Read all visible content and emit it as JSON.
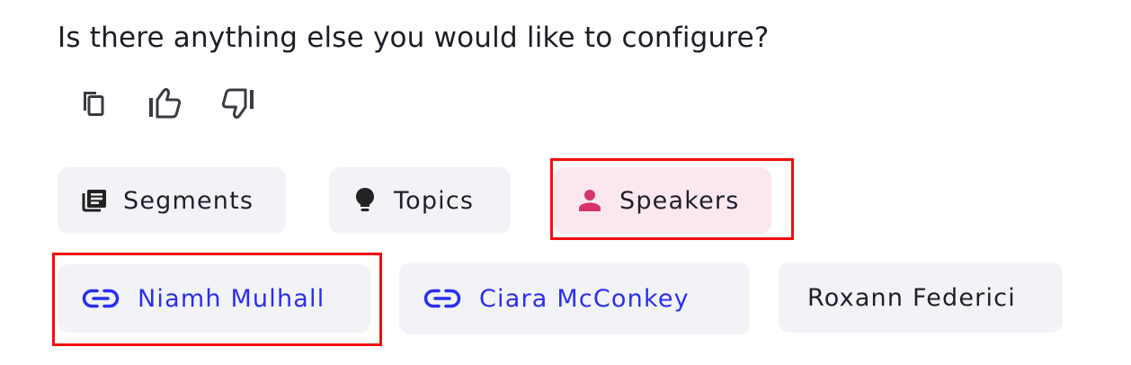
{
  "message": {
    "text": "Is there anything else you would like to configure?"
  },
  "actions": {
    "copy_icon": "copy-icon",
    "thumbs_up_icon": "thumbs-up-icon",
    "thumbs_down_icon": "thumbs-down-icon"
  },
  "categories": [
    {
      "label": "Segments",
      "icon": "newspaper-icon",
      "selected": false
    },
    {
      "label": "Topics",
      "icon": "lightbulb-icon",
      "selected": false
    },
    {
      "label": "Speakers",
      "icon": "person-icon",
      "selected": true
    }
  ],
  "speakers": [
    {
      "label": "Niamh Mulhall",
      "icon": "link-icon",
      "linked": true
    },
    {
      "label": "Ciara McConkey",
      "icon": "link-icon",
      "linked": true
    },
    {
      "label": "Roxann Federici",
      "linked": false
    }
  ],
  "colors": {
    "link_blue": "#2b2ef0",
    "selected_pink_bg": "#fbe8ef",
    "selected_pink_icon": "#d6336c",
    "chip_bg": "#f2f3f7",
    "highlight_red": "#f20d0d"
  }
}
